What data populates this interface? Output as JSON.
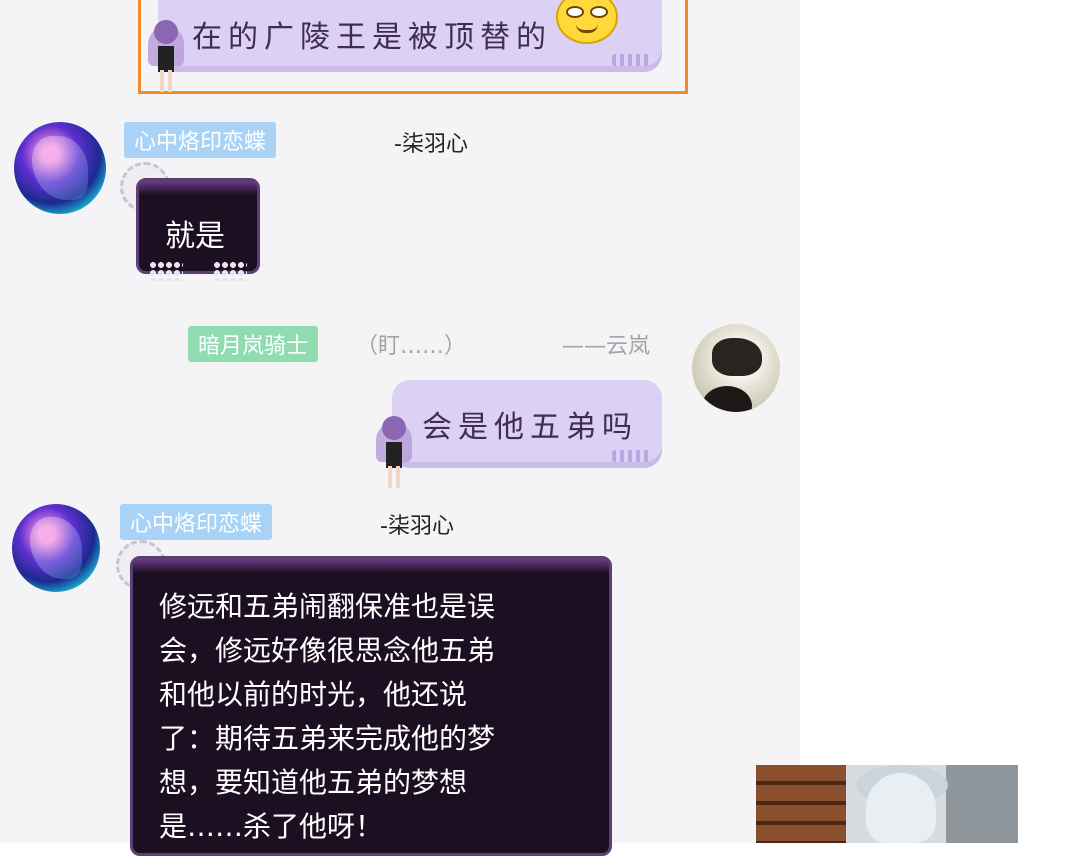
{
  "messages": [
    {
      "text": "在的广陵王是被顶替的",
      "side": "right",
      "highlighted": true
    },
    {
      "tag": "心中烙印恋蝶",
      "nickname": "-柒羽心",
      "text": "就是"
    },
    {
      "tag": "暗月岚骑士",
      "note": "（盯……）",
      "nickname": "——云岚",
      "text": "会是他五弟吗",
      "side": "right"
    },
    {
      "tag": "心中烙印恋蝶",
      "nickname": "-柒羽心",
      "lines": [
        "修远和五弟闹翻保准也是误",
        "会，修远好像很思念他五弟",
        "和他以前的时光，他还说",
        "了：期待五弟来完成他的梦",
        "想，要知道他五弟的梦想",
        "是……杀了他呀！"
      ]
    }
  ],
  "colors": {
    "highlight_border": "#f08a2a",
    "light_bubble": "#dcd0f4",
    "dark_bubble": "#1c0f22",
    "tag_blue": "#a8d2f6",
    "tag_green": "#8fdcb1"
  }
}
